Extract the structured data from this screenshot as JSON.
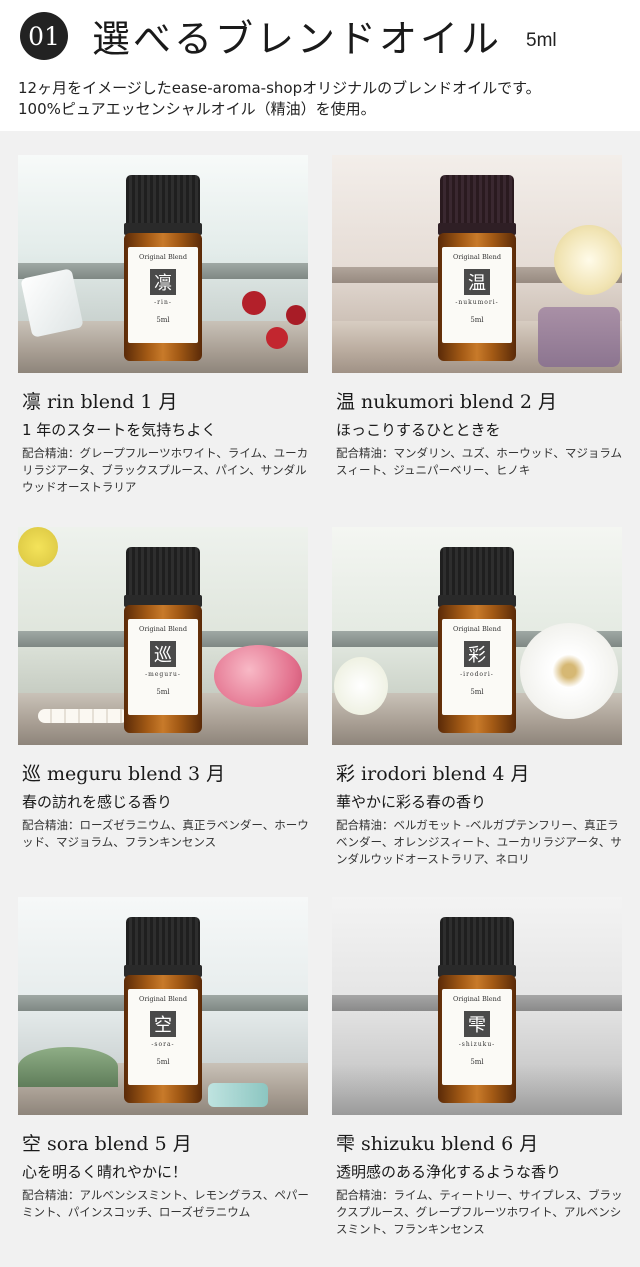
{
  "header": {
    "badge": "01",
    "title": "選べるブレンドオイル",
    "volume": "5ml",
    "intro_line1": "12ヶ月をイメージしたease-aroma-shopオリジナルのブレンドオイルです。",
    "intro_line2": "100%ピュアエッセンシャルオイル（精油）を使用。"
  },
  "label_common": {
    "brand": "Original Blend",
    "volume": "5ml"
  },
  "blends": [
    {
      "kanji": "凛",
      "romaji": "-rin-",
      "title": "凛 rin blend 1 月",
      "subtitle": "1 年のスタートを気持ちよく",
      "oils": "配合精油：グレープフルーツホワイト、ライム、ユーカリラジアータ、ブラックスプルース、パイン、サンダルウッドオーストラリア"
    },
    {
      "kanji": "温",
      "romaji": "-nukumori-",
      "title": "温 nukumori blend 2 月",
      "subtitle": "ほっこりするひとときを",
      "oils": "配合精油：マンダリン、ユズ、ホーウッド、マジョラムスィート、ジュニパーベリー、ヒノキ"
    },
    {
      "kanji": "巡",
      "romaji": "-meguru-",
      "title": "巡 meguru blend 3 月",
      "subtitle": "春の訪れを感じる香り",
      "oils": "配合精油：ローズゼラニウム、真正ラベンダー、ホーウッド、マジョラム、フランキンセンス"
    },
    {
      "kanji": "彩",
      "romaji": "-irodori-",
      "title": "彩 irodori blend 4 月",
      "subtitle": "華やかに彩る春の香り",
      "oils": "配合精油：ベルガモット -ベルガプテンフリー、真正ラベンダー、オレンジスィート、ユーカリラジアータ、サンダルウッドオーストラリア、ネロリ"
    },
    {
      "kanji": "空",
      "romaji": "-sora-",
      "title": "空 sora blend 5 月",
      "subtitle": "心を明るく晴れやかに！",
      "oils": "配合精油：アルベンシスミント、レモングラス、ペパーミント、パインスコッチ、ローズゼラニウム"
    },
    {
      "kanji": "雫",
      "romaji": "-shizuku-",
      "title": "雫 shizuku blend 6 月",
      "subtitle": "透明感のある浄化するような香り",
      "oils": "配合精油：ライム、ティートリー、サイプレス、ブラックスプルース、グレープフルーツホワイト、アルベンシスミント、フランキンセンス"
    }
  ]
}
